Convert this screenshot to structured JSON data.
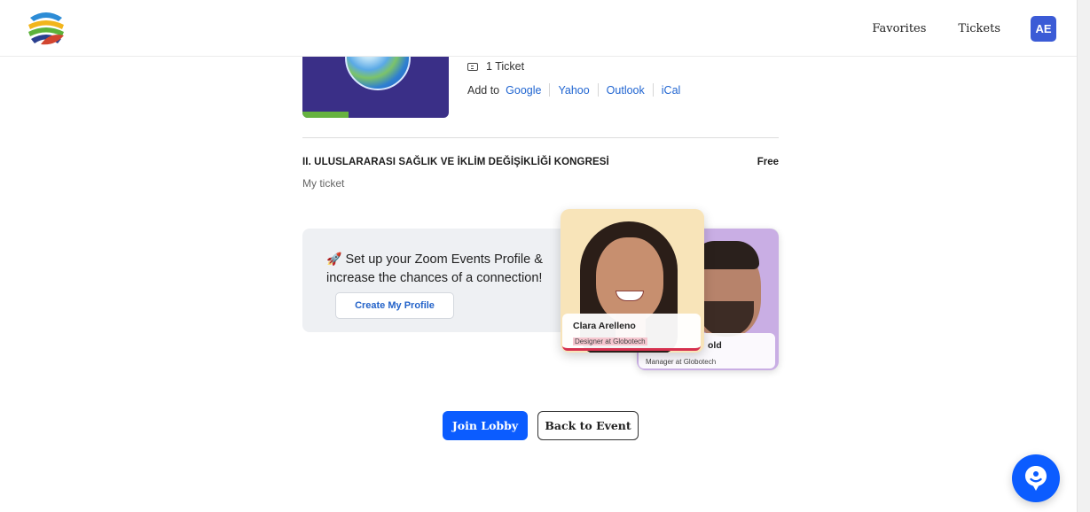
{
  "header": {
    "logo_icon": "globe-leaf-logo",
    "nav": {
      "favorites": "Favorites",
      "tickets": "Tickets"
    },
    "avatar_initials": "AE"
  },
  "event_summary": {
    "thumbnail_icon": "event-banner-image",
    "ticket_count": "1 Ticket",
    "add_to_label": "Add to",
    "calendars": [
      "Google",
      "Yahoo",
      "Outlook",
      "iCal"
    ]
  },
  "ticket_item": {
    "title": "II. ULUSLARARASI SAĞLIK VE İKLİM DEĞİŞİKLİĞİ KONGRESİ",
    "price": "Free",
    "subtitle": "My ticket"
  },
  "profile_promo": {
    "emoji_icon": "rocket-icon",
    "text": "Set up your Zoom Events Profile & increase the chances of a connection!",
    "button_label": "Create My Profile",
    "front_card": {
      "name": "Clara Arelleno",
      "role": "Designer at Globotech"
    },
    "back_card": {
      "name_fragment": "old",
      "role": "Manager at Globotech"
    }
  },
  "actions": {
    "join": "Join Lobby",
    "back": "Back to Event"
  },
  "chat_fab_icon": "chat-assistant-icon",
  "colors": {
    "primary": "#0b5cff",
    "link": "#2065d1",
    "avatar": "#3b5bd6"
  }
}
